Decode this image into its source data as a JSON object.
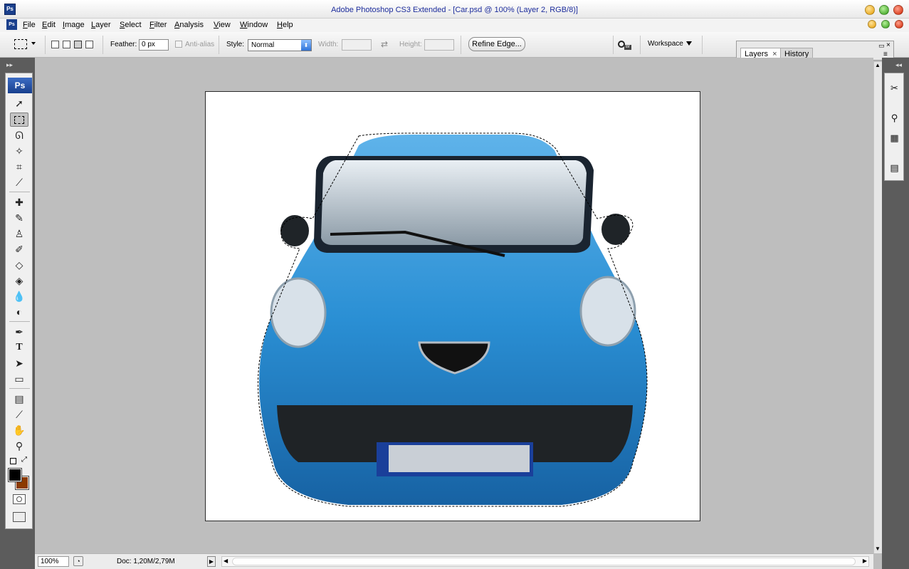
{
  "window": {
    "title": "Adobe Photoshop CS3 Extended - [Car.psd @ 100% (Layer 2, RGB/8)]",
    "app_icon": "Ps",
    "doc_icon": "Ps"
  },
  "menu": {
    "items": [
      "File",
      "Edit",
      "Image",
      "Layer",
      "Select",
      "Filter",
      "Analysis",
      "View",
      "Window",
      "Help"
    ]
  },
  "options_bar": {
    "feather_label": "Feather:",
    "feather_value": "0 px",
    "antialias_label": "Anti-alias",
    "style_label": "Style:",
    "style_value": "Normal",
    "width_label": "Width:",
    "height_label": "Height:",
    "refine_edge_label": "Refine Edge...",
    "workspace_label": "Workspace"
  },
  "panels": {
    "tabs": [
      {
        "label": "Layers",
        "active": true
      },
      {
        "label": "History",
        "active": false
      }
    ]
  },
  "toolbox": {
    "logo": "Ps",
    "tools": [
      "move-icon",
      "rectangular-marquee-icon",
      "lasso-icon",
      "magic-wand-icon",
      "crop-icon",
      "slice-icon",
      "healing-brush-icon",
      "brush-icon",
      "clone-stamp-icon",
      "history-brush-icon",
      "eraser-icon",
      "paint-bucket-icon",
      "blur-icon",
      "dodge-icon",
      "pen-icon",
      "type-icon",
      "path-selection-icon",
      "rectangle-icon",
      "notes-icon",
      "eyedropper-icon",
      "hand-icon",
      "zoom-icon"
    ],
    "foreground_color": "#000000",
    "background_color": "#8b3a00"
  },
  "status": {
    "zoom": "100%",
    "doc_size": "Doc: 1,20M/2,79M"
  },
  "colors": {
    "car_body": "#2a8fd4",
    "selection_outline": "#000000"
  }
}
